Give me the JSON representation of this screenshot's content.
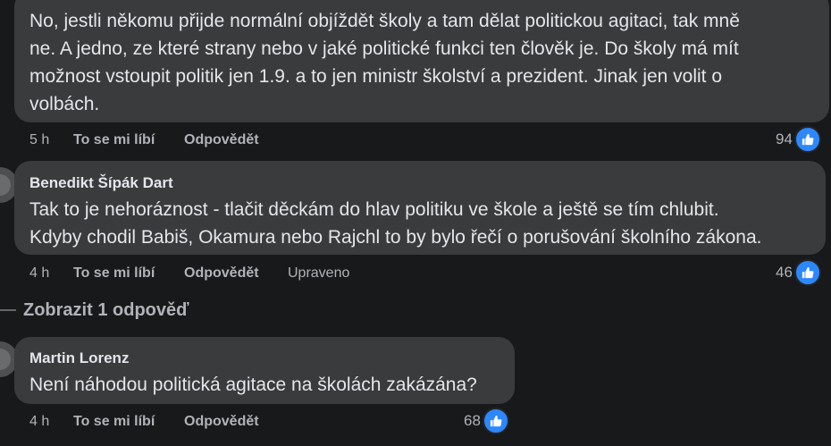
{
  "comments": [
    {
      "text": "No, jestli někomu přijde normální objíždět školy a tam dělat politickou agitaci, tak mně ne. A jedno, ze které strany nebo v jaké politické funkci ten člověk je. Do školy má mít možnost vstoupit politik jen 1.9. a to jen ministr školství a prezident. Jinak jen volit o volbách.",
      "lines": [
        "No, jestli někomu přijde normální objíždět školy a tam dělat politickou agitaci, tak mně",
        "ne. A jedno, ze které strany nebo v jaké politické funkci ten člověk je. Do školy má mít",
        "možnost vstoupit politik jen 1.9. a to jen ministr školství a prezident. Jinak jen volit o",
        "volbách."
      ],
      "time": "5 h",
      "like_label": "To se mi líbí",
      "reply_label": "Odpovědět",
      "likes": "94"
    },
    {
      "author": "Benedikt Šípák Dart",
      "lines": [
        "Tak to je nehoráznost - tlačit děckám do hlav politiku ve škole a ještě se tím chlubit.",
        "Kdyby chodil Babiš, Okamura nebo Rajchl to by bylo řečí o porušování školního zákona."
      ],
      "time": "4 h",
      "like_label": "To se mi líbí",
      "reply_label": "Odpovědět",
      "edited_label": "Upraveno",
      "likes": "46"
    },
    {
      "author": "Martin Lorenz",
      "lines": [
        "Není náhodou politická agitace na školách zakázána?"
      ],
      "time": "4 h",
      "like_label": "To se mi líbí",
      "reply_label": "Odpovědět",
      "likes": "68"
    }
  ],
  "show_replies_label": "Zobrazit 1 odpověď",
  "colors": {
    "background": "#18191a",
    "bubble": "#3a3b3c",
    "text": "#e4e6eb",
    "meta": "#b0b3b8",
    "like_blue": "#2d88ff"
  },
  "icons": [
    "thumbs-up-icon",
    "avatar"
  ]
}
